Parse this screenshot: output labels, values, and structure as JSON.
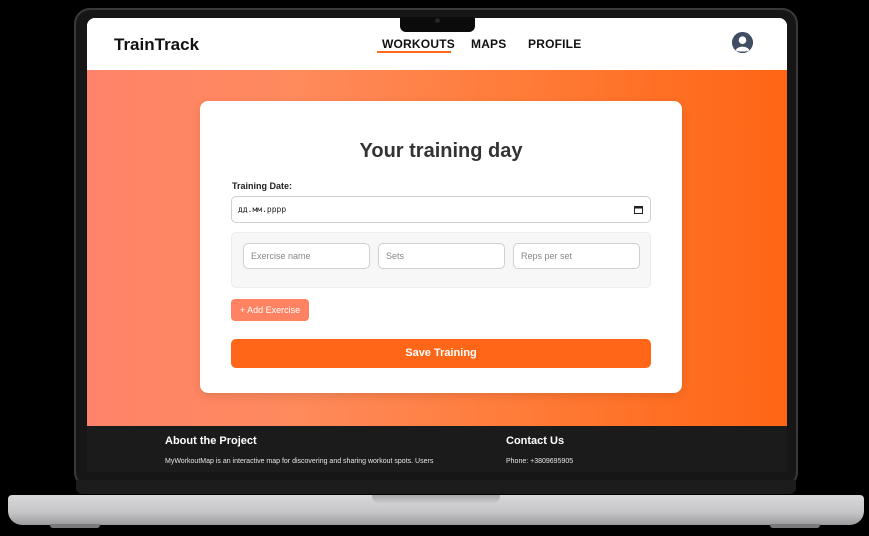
{
  "app": {
    "name": "TrainTrack"
  },
  "nav": {
    "items": [
      {
        "label": "WORKOUTS",
        "active": true
      },
      {
        "label": "MAPS",
        "active": false
      },
      {
        "label": "PROFILE",
        "active": false
      }
    ]
  },
  "form": {
    "title": "Your training day",
    "date_label": "Training Date:",
    "date_placeholder": "дд.мм.рррр",
    "exercise": {
      "name_placeholder": "Exercise name",
      "sets_placeholder": "Sets",
      "reps_placeholder": "Reps per set"
    },
    "add_button": "+ Add Exercise",
    "save_button": "Save Training"
  },
  "footer": {
    "about_heading": "About the Project",
    "about_text": "MyWorkoutMap is an interactive map for discovering and sharing workout spots. Users",
    "contact_heading": "Contact Us",
    "contact_phone": "Phone: +3809695905"
  },
  "colors": {
    "accent": "#ff6618",
    "add_button": "#ff8362",
    "footer_bg": "#1b1b1b",
    "hero_start": "#ff836a",
    "hero_end": "#ff6514"
  },
  "icons": [
    "calendar-icon",
    "user-avatar-icon"
  ]
}
